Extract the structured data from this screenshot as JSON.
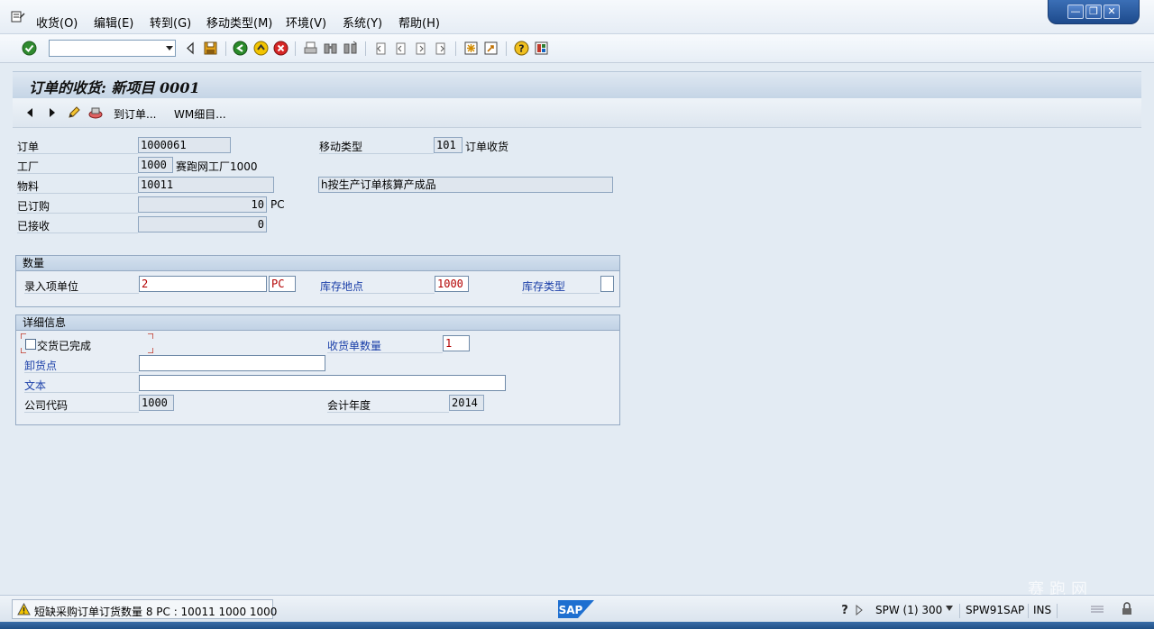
{
  "menu": {
    "items": [
      "收货(O)",
      "编辑(E)",
      "转到(G)",
      "移动类型(M)",
      "环境(V)",
      "系统(Y)",
      "帮助(H)"
    ]
  },
  "window_controls": {
    "minimize": "—",
    "restore": "❐",
    "close": "✕"
  },
  "toolbar": {
    "command_field_value": ""
  },
  "title": "订单的收货: 新项目 0001",
  "app_toolbar": {
    "to_order": "到订单...",
    "wm_detail": "WM细目..."
  },
  "header": {
    "order_label": "订单",
    "order_value": "1000061",
    "plant_label": "工厂",
    "plant_value": "1000",
    "plant_text": "赛跑网工厂1000",
    "material_label": "物料",
    "material_value": "10011",
    "ordered_label": "已订购",
    "ordered_value": "10",
    "ordered_unit": "PC",
    "received_label": "已接收",
    "received_value": "0",
    "movement_type_label": "移动类型",
    "movement_type_value": "101",
    "movement_type_text": "订单收货",
    "material_text": "h按生产订单核算产成品"
  },
  "quantity_group": {
    "title": "数量",
    "entry_unit_label": "录入项单位",
    "entry_qty": "2",
    "entry_unit": "PC",
    "storage_location_label": "库存地点",
    "storage_location_value": "1000",
    "stock_type_label": "库存类型",
    "stock_type_value": ""
  },
  "detail_group": {
    "title": "详细信息",
    "delivery_completed_label": "交货已完成",
    "delivery_completed_checked": false,
    "gr_slips_label": "收货单数量",
    "gr_slips_value": "1",
    "unloading_point_label": "卸货点",
    "unloading_point_value": "",
    "text_label": "文本",
    "text_value": "",
    "company_code_label": "公司代码",
    "company_code_value": "1000",
    "fiscal_year_label": "会计年度",
    "fiscal_year_value": "2014"
  },
  "status": {
    "message": "短缺采购订单订货数量 8 PC : 10011 1000 1000",
    "system": "SPW (1) 300",
    "server": "SPW91SAP",
    "mode": "INS",
    "logo": "SAP"
  },
  "watermark": "赛跑网"
}
